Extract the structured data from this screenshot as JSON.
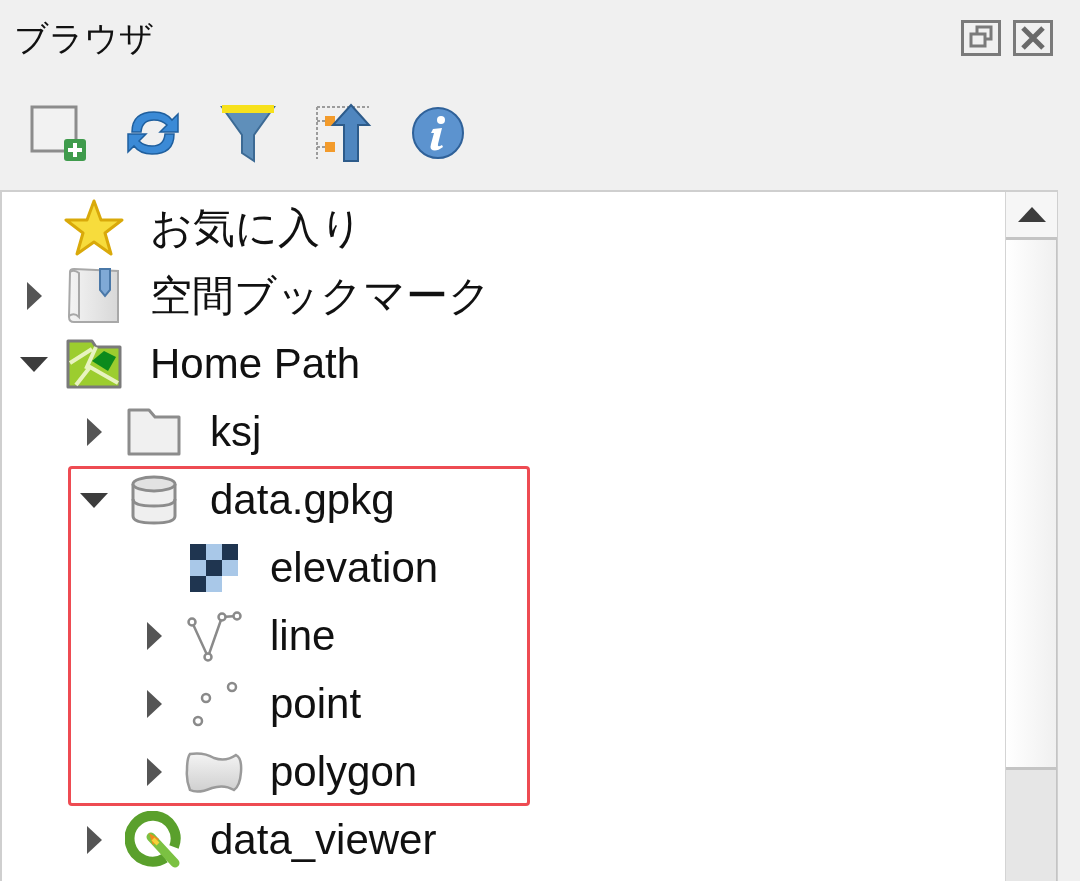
{
  "panel": {
    "title": "ブラウザ"
  },
  "tree": {
    "items": [
      {
        "label": "お気に入り",
        "kind": "favorites"
      },
      {
        "label": "空間ブックマーク",
        "kind": "bookmarks",
        "expanded": false
      },
      {
        "label": "Home Path",
        "kind": "home",
        "expanded": true,
        "children": [
          {
            "label": "ksj",
            "kind": "folder",
            "expanded": false
          },
          {
            "label": "data.gpkg",
            "kind": "geopackage",
            "expanded": true,
            "highlighted": true,
            "children": [
              {
                "label": "elevation",
                "kind": "raster"
              },
              {
                "label": "line",
                "kind": "line",
                "expanded": false
              },
              {
                "label": "point",
                "kind": "point",
                "expanded": false
              },
              {
                "label": "polygon",
                "kind": "polygon",
                "expanded": false
              }
            ]
          },
          {
            "label": "data_viewer",
            "kind": "project",
            "expanded": false
          }
        ]
      }
    ]
  }
}
